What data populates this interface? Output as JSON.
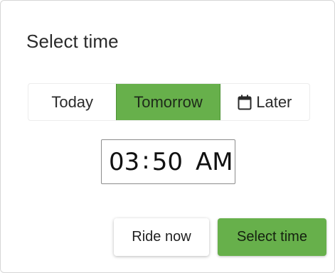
{
  "dialog": {
    "title": "Select time",
    "day_options": [
      {
        "label": "Today",
        "selected": false
      },
      {
        "label": "Tomorrow",
        "selected": true
      },
      {
        "label": "Later",
        "selected": false,
        "icon": "calendar-icon"
      }
    ],
    "time": {
      "hour": "03",
      "separator": ":",
      "minute": "50",
      "period": "AM"
    },
    "buttons": {
      "ride_now": "Ride now",
      "select_time": "Select time"
    }
  },
  "colors": {
    "accent": "#67b04b",
    "text": "#212121"
  }
}
